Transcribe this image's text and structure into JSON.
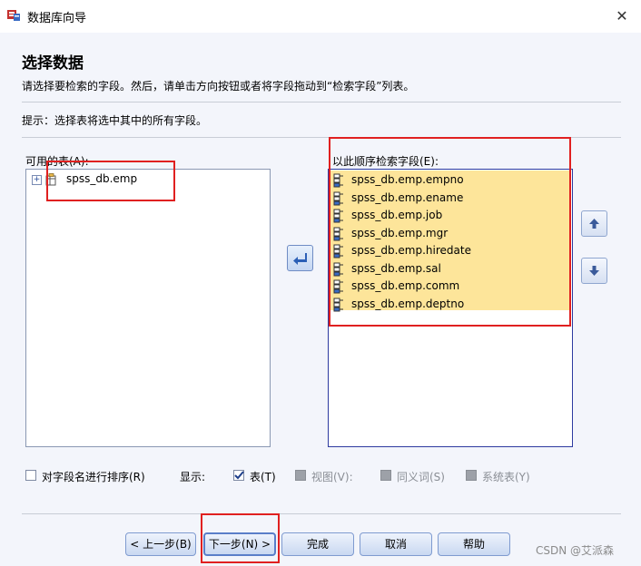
{
  "window": {
    "title": "数据库向导",
    "close_glyph": "✕"
  },
  "page": {
    "heading": "选择数据",
    "description": "请选择要检索的字段。然后，请单击方向按钮或者将字段拖动到“检索字段”列表。",
    "hint": "提示：选择表将选中其中的所有字段。"
  },
  "available": {
    "label": "可用的表(A):",
    "tables": [
      {
        "name": "spss_db.emp"
      }
    ]
  },
  "selected": {
    "label": "以此顺序检索字段(E):",
    "fields": [
      "spss_db.emp.empno",
      "spss_db.emp.ename",
      "spss_db.emp.job",
      "spss_db.emp.mgr",
      "spss_db.emp.hiredate",
      "spss_db.emp.sal",
      "spss_db.emp.comm",
      "spss_db.emp.deptno"
    ]
  },
  "options": {
    "sort_label": "对字段名进行排序(R)",
    "sort_checked": false,
    "show_label": "显示:",
    "tables_label": "表(T)",
    "tables_checked": true,
    "views_label": "视图(V):",
    "synonyms_label": "同义词(S)",
    "system_tables_label": "系统表(Y)"
  },
  "buttons": {
    "back": "< 上一步(B)",
    "next": "下一步(N) >",
    "finish": "完成",
    "cancel": "取消",
    "help": "帮助"
  },
  "watermark": "CSDN @艾派森",
  "colors": {
    "highlight": "#fde59a",
    "annotation": "#e02020",
    "panel": "#f3f5fb"
  }
}
